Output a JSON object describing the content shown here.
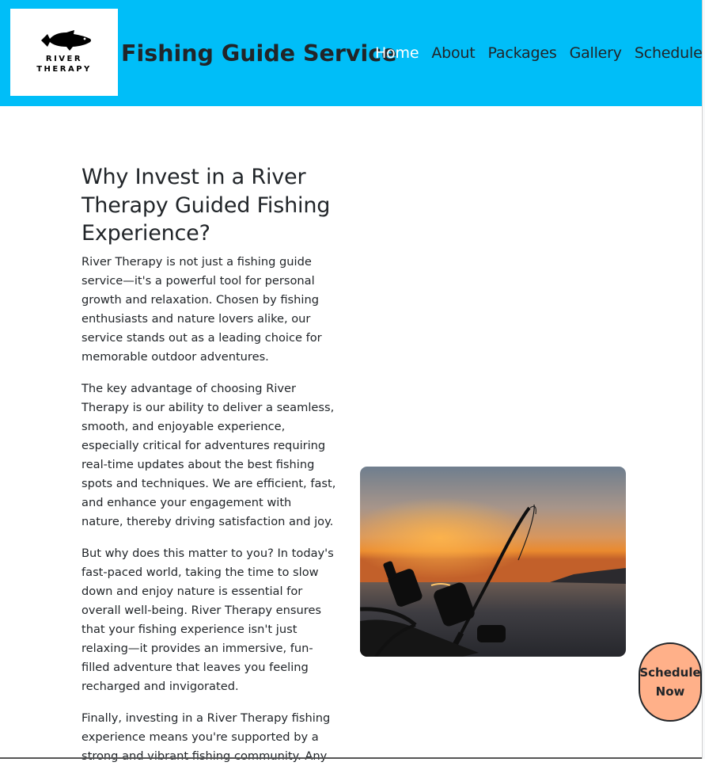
{
  "header": {
    "logo": {
      "line1": "RIVER",
      "line2": "THERAPY"
    },
    "title": "Fishing Guide Service",
    "nav": [
      {
        "label": "Home",
        "active": true
      },
      {
        "label": "About"
      },
      {
        "label": "Packages"
      },
      {
        "label": "Gallery"
      },
      {
        "label": "Schedule"
      }
    ]
  },
  "main": {
    "heading": "Why Invest in a River Therapy Guided Fishing Experience?",
    "paragraphs": [
      "River Therapy is not just a fishing guide service—it's a powerful tool for personal growth and relaxation. Chosen by fishing enthusiasts and nature lovers alike, our service stands out as a leading choice for memorable outdoor adventures.",
      "The key advantage of choosing River Therapy is our ability to deliver a seamless, smooth, and enjoyable experience, especially critical for adventures requiring real-time updates about the best fishing spots and techniques. We are efficient, fast, and enhance your engagement with nature, thereby driving satisfaction and joy.",
      "But why does this matter to you? In today's fast-paced world, taking the time to slow down and enjoy nature is essential for overall well-being. River Therapy ensures that your fishing experience isn't just relaxing—it provides an immersive, fun-filled adventure that leaves you feeling recharged and invigorated.",
      "Finally, investing in a River Therapy fishing experience means you're supported by a strong and vibrant fishing community. Any"
    ]
  },
  "cta": {
    "label": "Schedule Now"
  },
  "colors": {
    "header_bg": "#00bef8",
    "cta_bg": "#ffb089",
    "nav_active": "#ffffff",
    "text": "#212529"
  }
}
